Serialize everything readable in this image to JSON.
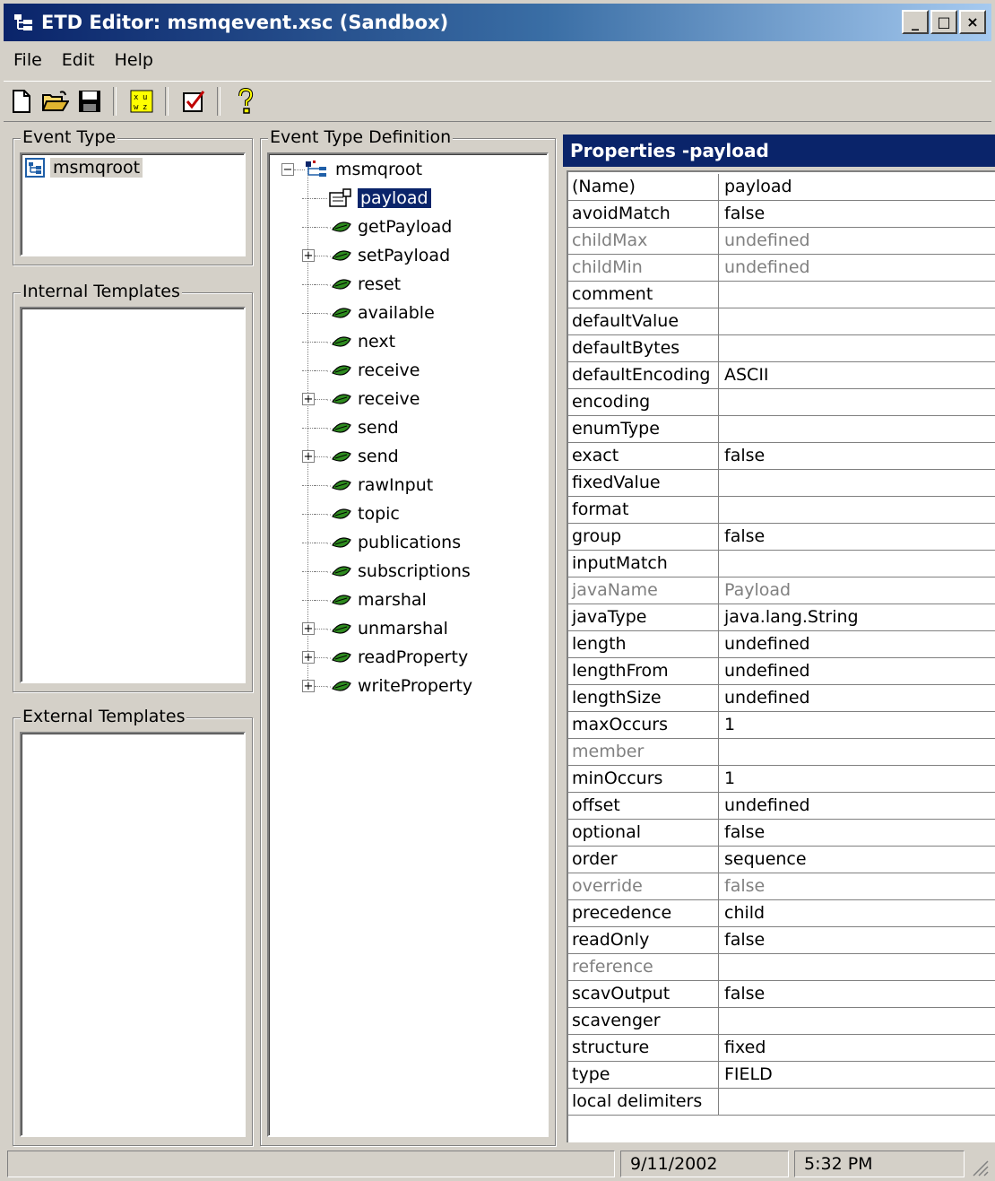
{
  "window": {
    "title": "ETD Editor: msmqevent.xsc (Sandbox)",
    "controls": {
      "minimize": "_",
      "maximize": "□",
      "close": "×"
    }
  },
  "menu": [
    "File",
    "Edit",
    "Help"
  ],
  "toolbar": {
    "buttons": [
      "new-icon",
      "open-folder-icon",
      "save-icon",
      "grid-icon",
      "checklist-icon",
      "help-icon"
    ]
  },
  "event_type": {
    "label": "Event Type",
    "item": "msmqroot"
  },
  "internal_templates": {
    "label": "Internal Templates"
  },
  "external_templates": {
    "label": "External Templates"
  },
  "etd_tree": {
    "label": "Event Type Definition",
    "root": "msmqroot",
    "nodes": [
      {
        "label": "payload",
        "expandable": false,
        "selected": true
      },
      {
        "label": "getPayload",
        "expandable": false
      },
      {
        "label": "setPayload",
        "expandable": true
      },
      {
        "label": "reset",
        "expandable": false
      },
      {
        "label": "available",
        "expandable": false
      },
      {
        "label": "next",
        "expandable": false
      },
      {
        "label": "receive",
        "expandable": false
      },
      {
        "label": "receive",
        "expandable": true
      },
      {
        "label": "send",
        "expandable": false
      },
      {
        "label": "send",
        "expandable": true
      },
      {
        "label": "rawInput",
        "expandable": false
      },
      {
        "label": "topic",
        "expandable": false
      },
      {
        "label": "publications",
        "expandable": false
      },
      {
        "label": "subscriptions",
        "expandable": false
      },
      {
        "label": "marshal",
        "expandable": false
      },
      {
        "label": "unmarshal",
        "expandable": true
      },
      {
        "label": "readProperty",
        "expandable": true
      },
      {
        "label": "writeProperty",
        "expandable": true
      }
    ]
  },
  "properties": {
    "title": "Properties -payload",
    "rows": [
      {
        "name": "(Name)",
        "value": "payload"
      },
      {
        "name": "avoidMatch",
        "value": "false"
      },
      {
        "name": "childMax",
        "value": "undefined",
        "disabled": true
      },
      {
        "name": "childMin",
        "value": "undefined",
        "disabled": true
      },
      {
        "name": "comment",
        "value": ""
      },
      {
        "name": "defaultValue",
        "value": ""
      },
      {
        "name": "defaultBytes",
        "value": ""
      },
      {
        "name": "defaultEncoding",
        "value": "ASCII"
      },
      {
        "name": "encoding",
        "value": ""
      },
      {
        "name": "enumType",
        "value": ""
      },
      {
        "name": "exact",
        "value": "false"
      },
      {
        "name": "fixedValue",
        "value": ""
      },
      {
        "name": "format",
        "value": ""
      },
      {
        "name": "group",
        "value": "false"
      },
      {
        "name": "inputMatch",
        "value": ""
      },
      {
        "name": "javaName",
        "value": "Payload",
        "disabled": true
      },
      {
        "name": "javaType",
        "value": "java.lang.String"
      },
      {
        "name": "length",
        "value": "undefined"
      },
      {
        "name": "lengthFrom",
        "value": "undefined"
      },
      {
        "name": "lengthSize",
        "value": "undefined"
      },
      {
        "name": "maxOccurs",
        "value": "1"
      },
      {
        "name": "member",
        "value": "",
        "disabled": true
      },
      {
        "name": "minOccurs",
        "value": "1"
      },
      {
        "name": "offset",
        "value": "undefined"
      },
      {
        "name": "optional",
        "value": "false"
      },
      {
        "name": "order",
        "value": "sequence"
      },
      {
        "name": "override",
        "value": "false",
        "disabled": true
      },
      {
        "name": "precedence",
        "value": "child"
      },
      {
        "name": "readOnly",
        "value": "false"
      },
      {
        "name": "reference",
        "value": "",
        "disabled": true
      },
      {
        "name": "scavOutput",
        "value": "false"
      },
      {
        "name": "scavenger",
        "value": ""
      },
      {
        "name": "structure",
        "value": "fixed"
      },
      {
        "name": "type",
        "value": "FIELD"
      },
      {
        "name": "local delimiters",
        "value": ""
      }
    ]
  },
  "status": {
    "date": "9/11/2002",
    "time": "5:32 PM"
  },
  "colors": {
    "title_bar": "#0a246a",
    "face": "#d4d0c8",
    "node_green": "#2e8b1f"
  }
}
